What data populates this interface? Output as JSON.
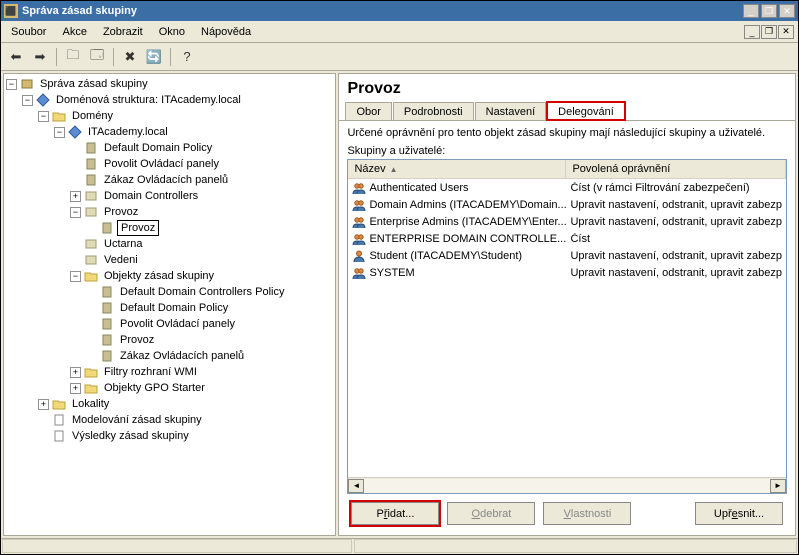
{
  "window": {
    "title": "Správa zásad skupiny"
  },
  "menu": {
    "soubor": "Soubor",
    "akce": "Akce",
    "zobrazit": "Zobrazit",
    "okno": "Okno",
    "napoveda": "Nápověda"
  },
  "tree": {
    "root": "Správa zásad skupiny",
    "forest": "Doménová struktura: ITAcademy.local",
    "domains": "Domény",
    "domain": "ITAcademy.local",
    "ddp": "Default Domain Policy",
    "pop": "Povolit Ovládací panely",
    "zop": "Zákaz Ovládacích panelů",
    "dc": "Domain Controllers",
    "provoz": "Provoz",
    "provoz2": "Provoz",
    "uctarna": "Uctarna",
    "vedeni": "Vedeni",
    "ozs": "Objekty zásad skupiny",
    "ddcp": "Default Domain Controllers Policy",
    "ddp2": "Default Domain Policy",
    "pop2": "Povolit Ovládací panely",
    "provoz3": "Provoz",
    "zop2": "Zákaz Ovládacích panelů",
    "wmi": "Filtry rozhraní WMI",
    "starter": "Objekty GPO Starter",
    "lokality": "Lokality",
    "modelovani": "Modelování zásad skupiny",
    "vysledky": "Výsledky zásad skupiny"
  },
  "detail": {
    "title": "Provoz",
    "tabs": {
      "obor": "Obor",
      "podrobnosti": "Podrobnosti",
      "nastaveni": "Nastavení",
      "delegovani": "Delegování"
    },
    "desc": "Určené oprávnění pro tento objekt zásad skupiny mají následující skupiny a uživatelé.",
    "groupslabel": "Skupiny a uživatelé:",
    "cols": {
      "name": "Název",
      "perm": "Povolená oprávnění"
    },
    "rows": [
      {
        "name": "Authenticated Users",
        "perm": "Číst (v rámci Filtrování zabezpečení)",
        "type": "group"
      },
      {
        "name": "Domain Admins (ITACADEMY\\Domain...",
        "perm": "Upravit nastavení, odstranit, upravit zabezp",
        "type": "group"
      },
      {
        "name": "Enterprise Admins (ITACADEMY\\Enter...",
        "perm": "Upravit nastavení, odstranit, upravit zabezp",
        "type": "group"
      },
      {
        "name": "ENTERPRISE DOMAIN CONTROLLE...",
        "perm": "Číst",
        "type": "group"
      },
      {
        "name": "Student (ITACADEMY\\Student)",
        "perm": "Upravit nastavení, odstranit, upravit zabezp",
        "type": "user"
      },
      {
        "name": "SYSTEM",
        "perm": "Upravit nastavení, odstranit, upravit zabezp",
        "type": "group"
      }
    ],
    "buttons": {
      "pridat_pre": "P",
      "pridat_u": "ř",
      "pridat_post": "idat...",
      "odebrat_pre": "",
      "odebrat_u": "O",
      "odebrat_post": "debrat",
      "vlastnosti_pre": "",
      "vlastnosti_u": "V",
      "vlastnosti_post": "lastnosti",
      "upresnit_pre": "Upř",
      "upresnit_u": "e",
      "upresnit_post": "snit..."
    }
  }
}
